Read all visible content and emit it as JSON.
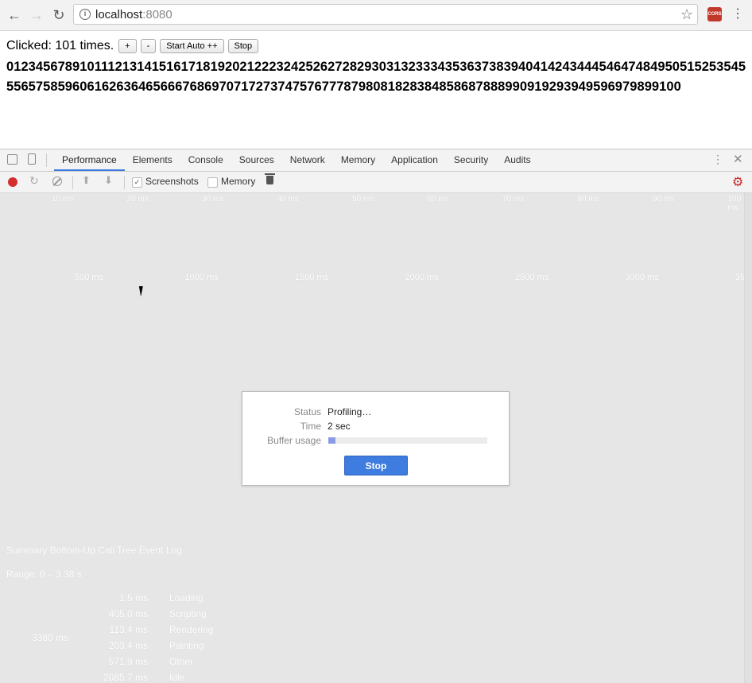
{
  "browser": {
    "url_host": "localhost",
    "url_port": ":8080",
    "back_icon": "arrow-left-icon",
    "forward_icon": "arrow-right-icon",
    "reload_icon": "reload-icon",
    "star_icon": "star-icon",
    "extension_label": "CORS"
  },
  "page": {
    "counter_text": "Clicked: 101 times.",
    "buttons": {
      "plus": "+",
      "minus": "-",
      "start_auto": "Start Auto ++",
      "stop": "Stop"
    },
    "numbers": "0123456789101112131415161718192021222324252627282930313233343536373839404142434445464748495051525354555657585960616263646566676869707172737475767778798081828384858687888990919293949596979899100"
  },
  "devtools": {
    "tabs": [
      "Performance",
      "Elements",
      "Console",
      "Sources",
      "Network",
      "Memory",
      "Application",
      "Security",
      "Audits"
    ],
    "active_tab": "Performance",
    "toolbar": {
      "screenshots_label": "Screenshots",
      "screenshots_checked": true,
      "memory_label": "Memory",
      "memory_checked": false
    },
    "overview_ticks": [
      "10 ms",
      "20 ms",
      "30 ms",
      "40 ms",
      "50 ms",
      "60 ms",
      "70 ms",
      "80 ms",
      "90 ms",
      "100 ms"
    ],
    "main_ticks": [
      "500 ms",
      "1000 ms",
      "1500 ms",
      "2000 ms",
      "2500 ms",
      "3000 ms",
      "35"
    ],
    "dialog": {
      "status_label": "Status",
      "status_value": "Profiling…",
      "time_label": "Time",
      "time_value": "2 sec",
      "buffer_label": "Buffer usage",
      "buffer_fraction": 0.045,
      "stop_label": "Stop",
      "accent": "#3e7cdf"
    },
    "summary": {
      "tabs_line": "Summary  Bottom-Up  Call Tree  Event Log",
      "range": "Range: 0 – 3.38 s",
      "total": "3380 ms",
      "rows": [
        {
          "value": "1.5 ms",
          "label": "Loading"
        },
        {
          "value": "405.0 ms",
          "label": "Scripting"
        },
        {
          "value": "113.4 ms",
          "label": "Rendering"
        },
        {
          "value": "203.4 ms",
          "label": "Painting"
        },
        {
          "value": "571.9 ms",
          "label": "Other"
        },
        {
          "value": "2085.7 ms",
          "label": "Idle"
        }
      ]
    }
  }
}
